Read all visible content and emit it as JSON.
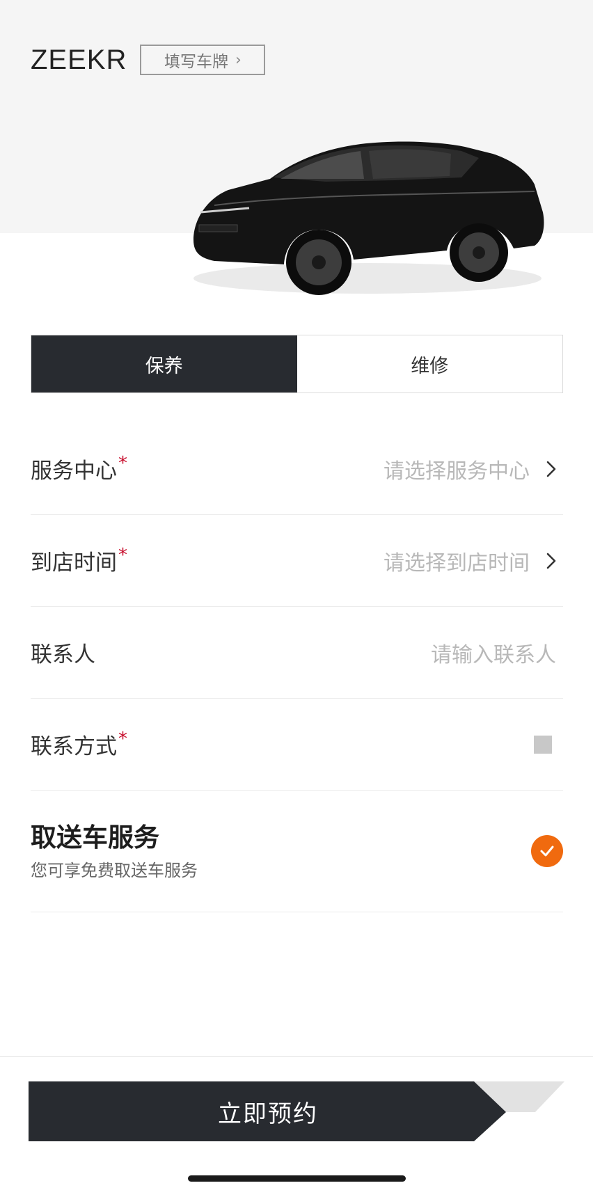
{
  "header": {
    "brand": "ZEEKR",
    "plate_button": "填写车牌"
  },
  "tabs": [
    {
      "label": "保养",
      "active": true
    },
    {
      "label": "维修",
      "active": false
    }
  ],
  "form": {
    "service_center": {
      "label": "服务中心",
      "required_mark": "*",
      "placeholder": "请选择服务中心"
    },
    "arrival_time": {
      "label": "到店时间",
      "required_mark": "*",
      "placeholder": "请选择到店时间"
    },
    "contact_person": {
      "label": "联系人",
      "placeholder": "请输入联系人"
    },
    "contact_method": {
      "label": "联系方式",
      "required_mark": "*"
    },
    "pickup_service": {
      "title": "取送车服务",
      "subtitle": "您可享免费取送车服务",
      "checked": true
    }
  },
  "cta": {
    "label": "立即预约"
  },
  "colors": {
    "dark": "#282b30",
    "accent_orange": "#f06a0f",
    "required_red": "#c8102e",
    "placeholder_gray": "#b8b8b8"
  },
  "icons": [
    "chevron-right-icon",
    "check-icon",
    "car-image"
  ]
}
